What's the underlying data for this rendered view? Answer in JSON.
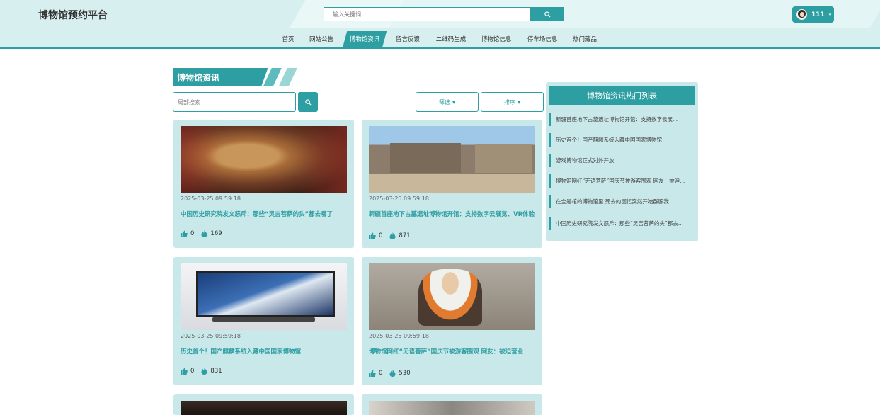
{
  "header": {
    "brand": "博物馆预约平台",
    "search_placeholder": "输入关键词",
    "user_name": "111"
  },
  "nav": {
    "items": [
      "首页",
      "网站公告",
      "博物馆资讯",
      "留言反馈",
      "二维码生成",
      "博物馆信息",
      "停车场信息",
      "热门藏品"
    ],
    "active_index": 2
  },
  "section": {
    "title": "博物馆资讯",
    "search_placeholder": "局部搜索",
    "filter_label": "筛选",
    "sort_label": "排序"
  },
  "cards": [
    {
      "date": "2025-03-25 09:59:18",
      "title": "中国历史研究院发文怒斥：那些“灵吉菩萨的头”都去哪了",
      "likes": "0",
      "views": "169",
      "image": "buddha-head"
    },
    {
      "date": "2025-03-25 09:59:18",
      "title": "新疆首座地下古墓遗址博物馆开馆：支持数字云展览、VR体验",
      "likes": "0",
      "views": "871",
      "image": "museum-building"
    },
    {
      "date": "2025-03-25 09:59:18",
      "title": "历史首个！国产麒麟系统入藏中国国家博物馆",
      "likes": "0",
      "views": "831",
      "image": "computer-monitor"
    },
    {
      "date": "2025-03-25 09:59:18",
      "title": "博物馆网红“无语菩萨”国庆节被游客围观 网友：被迫营业",
      "likes": "0",
      "views": "530",
      "image": "bodhisattva-statue"
    }
  ],
  "hot_list": {
    "title": "博物馆资讯热门列表",
    "items": [
      "新疆首座地下古墓遗址博物馆开馆：支持数字云展...",
      "历史首个！国产麒麟系统入藏中国国家博物馆",
      "游戏博物馆正式对外开放",
      "博物馆网红“无语菩萨”国庆节被游客围观 网友：被迫...",
      "在全是棺的博物馆里 死去的回忆突然开始群殴我",
      "中国历史研究院发文怒斥：那些“灵吉菩萨的头”都去..."
    ]
  },
  "colors": {
    "accent": "#2d9ea1",
    "card_bg": "#c9e8ea",
    "header_bg": "#d8eff0"
  }
}
